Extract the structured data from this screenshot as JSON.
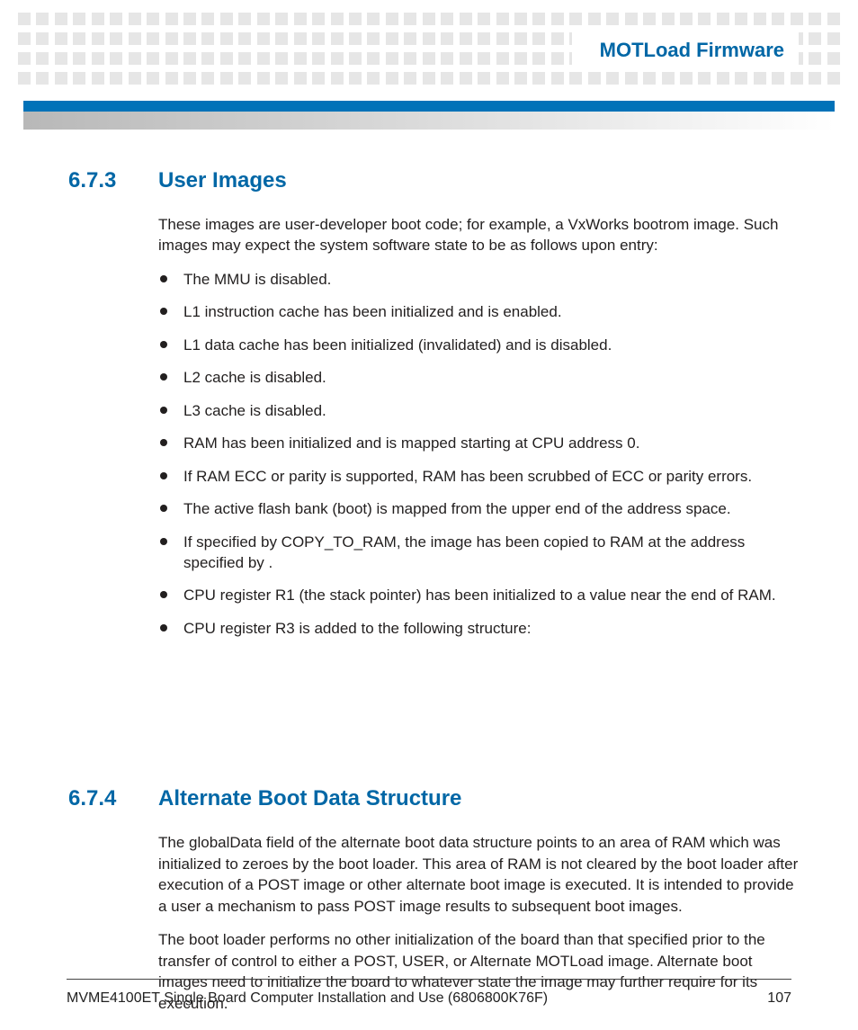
{
  "header": {
    "title": "MOTLoad Firmware"
  },
  "sections": [
    {
      "number": "6.7.3",
      "title": "User Images",
      "paragraphs": [
        "These images are user-developer boot code; for example, a VxWorks bootrom image. Such images may expect the system software state to be as follows upon entry:"
      ],
      "bullets": [
        "The MMU is disabled.",
        "L1 instruction cache has been initialized and is enabled.",
        "L1 data cache has been initialized (invalidated) and is disabled.",
        "L2 cache is disabled.",
        "L3 cache is disabled.",
        "RAM has been initialized and is mapped starting at CPU address 0.",
        "If RAM ECC or parity is supported, RAM has been scrubbed of ECC or parity errors.",
        "The active flash bank (boot) is mapped from the upper end of the address space.",
        "If specified by COPY_TO_RAM, the image has been copied to RAM at the address specified by                                        .",
        "CPU register R1 (the stack pointer) has been initialized to a value near the end of RAM.",
        "CPU register R3 is added to the following structure:"
      ]
    },
    {
      "number": "6.7.4",
      "title": "Alternate Boot Data Structure",
      "paragraphs": [
        "The globalData field of the alternate boot data structure points to an area of RAM which was initialized to zeroes by the boot loader. This area of RAM is not cleared by the boot loader after execution of a POST image or other alternate boot image is executed. It is intended to provide a user a mechanism to pass POST image results to subsequent boot images.",
        "The boot loader performs no other initialization of the board than that specified prior to the transfer of control to either a POST, USER, or Alternate MOTLoad image. Alternate boot images need to initialize the board to whatever state the image may further require for its execution."
      ],
      "bullets": []
    }
  ],
  "footer": {
    "left": "MVME4100ET Single Board Computer Installation and Use (6806800K76F)",
    "right": "107"
  }
}
